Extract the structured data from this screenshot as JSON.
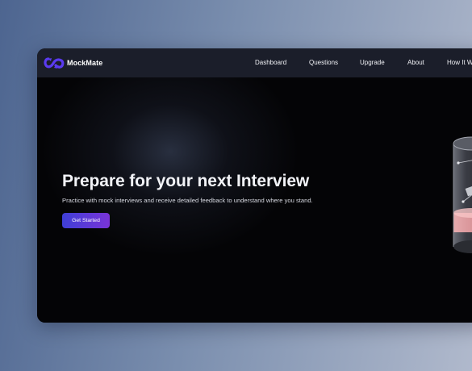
{
  "brand": {
    "name": "MockMate",
    "logo_icon": "infinity-link-icon",
    "accent": "#5b3bf0"
  },
  "nav": {
    "items": [
      {
        "label": "Dashboard"
      },
      {
        "label": "Questions"
      },
      {
        "label": "Upgrade"
      },
      {
        "label": "About"
      },
      {
        "label": "How It W"
      }
    ]
  },
  "hero": {
    "title": "Prepare for your next Interview",
    "subtitle": "Practice with mock interviews and receive detailed feedback to understand where you stand.",
    "cta_label": "Get Started",
    "cta_gradient": [
      "#3e3fd6",
      "#7a34d8"
    ],
    "illustration": "glass-cylinder-device-icon"
  }
}
